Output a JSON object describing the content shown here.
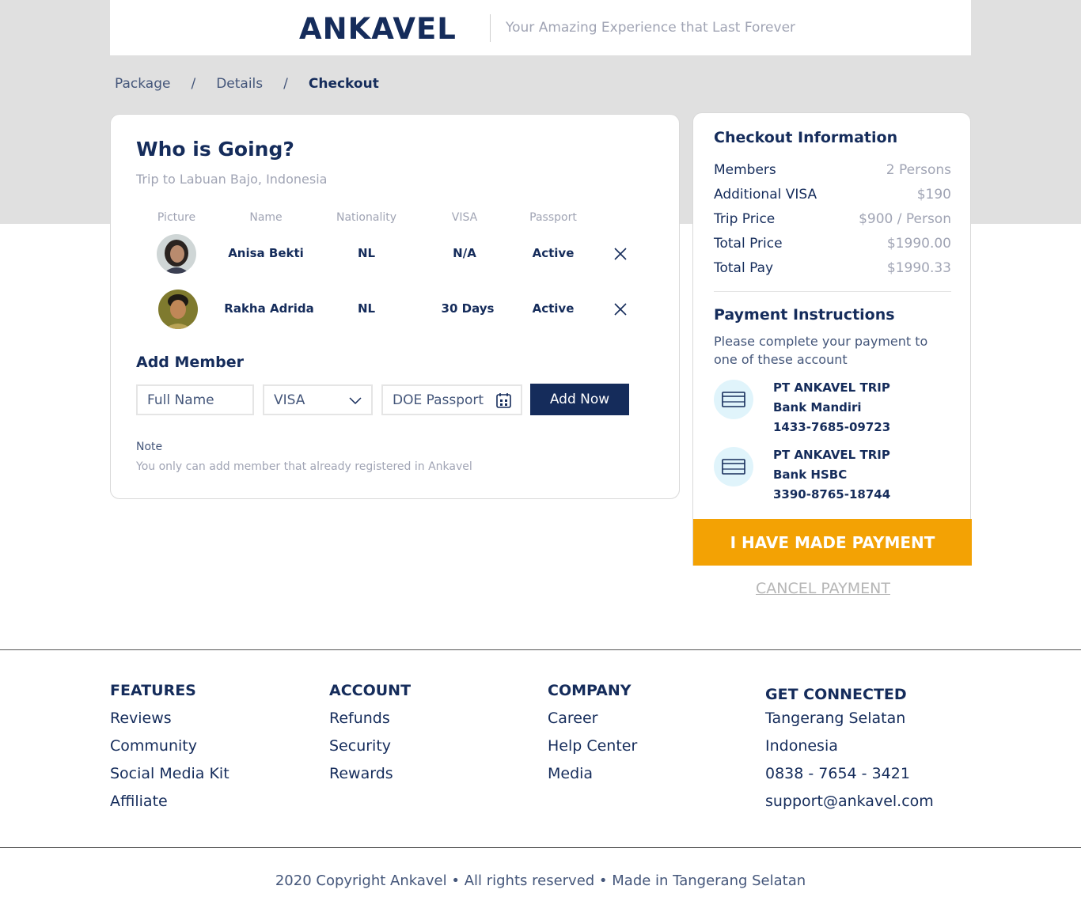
{
  "header": {
    "logo": "ANKAVEL",
    "tagline": "Your Amazing Experience that Last Forever"
  },
  "breadcrumb": {
    "items": [
      "Package",
      "Details",
      "Checkout"
    ],
    "separator": "/"
  },
  "who": {
    "title": "Who is Going?",
    "subtitle": "Trip to Labuan Bajo, Indonesia",
    "columns": [
      "Picture",
      "Name",
      "Nationality",
      "VISA",
      "Passport"
    ],
    "members": [
      {
        "name": "Anisa Bekti",
        "nationality": "NL",
        "visa": "N/A",
        "passport": "Active"
      },
      {
        "name": "Rakha Adrida",
        "nationality": "NL",
        "visa": "30 Days",
        "passport": "Active"
      }
    ]
  },
  "add_member": {
    "title": "Add Member",
    "name_placeholder": "Full Name",
    "visa_value": "VISA",
    "passport_placeholder": "DOE Passport",
    "button": "Add Now",
    "note_label": "Note",
    "note_text": "You only can add member that already registered in Ankavel"
  },
  "checkout": {
    "title": "Checkout Information",
    "rows": [
      {
        "label": "Members",
        "value": "2 Persons"
      },
      {
        "label": "Additional VISA",
        "value": "$190"
      },
      {
        "label": "Trip Price",
        "value": "$900 / Person"
      },
      {
        "label": "Total Price",
        "value": "$1990.00"
      },
      {
        "label": "Total Pay",
        "value": "$1990.33"
      }
    ],
    "payment_title": "Payment Instructions",
    "payment_text": "Please complete your payment to one of these account",
    "banks": [
      {
        "holder": "PT ANKAVEL TRIP",
        "bank": "Bank Mandiri",
        "account": "1433-7685-09723"
      },
      {
        "holder": "PT ANKAVEL TRIP",
        "bank": "Bank HSBC",
        "account": "3390-8765-18744"
      }
    ],
    "pay_button": "I HAVE MADE PAYMENT",
    "cancel_link": "CANCEL PAYMENT"
  },
  "footer": {
    "features": {
      "title": "FEATURES",
      "items": [
        "Reviews",
        "Community",
        "Social Media Kit",
        "Affiliate"
      ]
    },
    "account": {
      "title": "ACCOUNT",
      "items": [
        "Refunds",
        "Security",
        "Rewards"
      ]
    },
    "company": {
      "title": "COMPANY",
      "items": [
        "Career",
        "Help Center",
        "Media"
      ]
    },
    "connected": {
      "title": "GET CONNECTED",
      "items": [
        "Tangerang Selatan",
        "Indonesia",
        "0838 - 7654 - 3421",
        "support@ankavel.com"
      ]
    },
    "copyright": "2020 Copyright Ankavel • All rights reserved • Made in Tangerang Selatan"
  },
  "colors": {
    "primary": "#152c5b",
    "accent": "#f3a204",
    "muted": "#a0a4b4",
    "band": "#e0e0e0"
  }
}
